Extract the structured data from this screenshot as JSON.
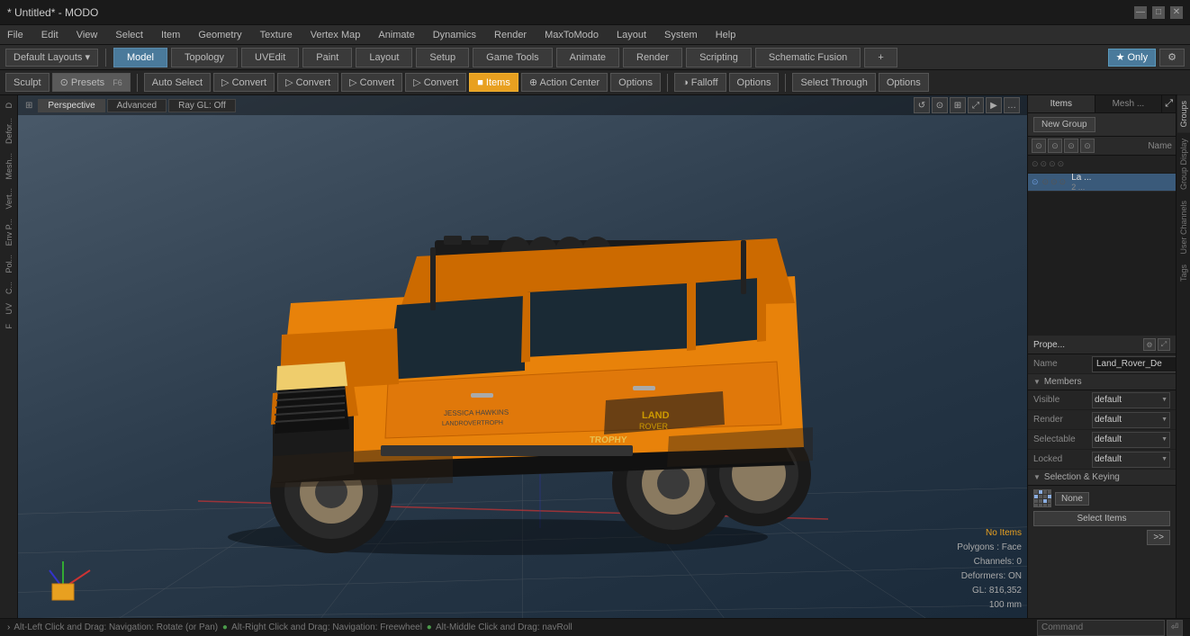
{
  "window": {
    "title": "* Untitled* - MODO",
    "controls": [
      "—",
      "□",
      "✕"
    ]
  },
  "menu": {
    "items": [
      "File",
      "Edit",
      "View",
      "Select",
      "Item",
      "Geometry",
      "Texture",
      "Vertex Map",
      "Animate",
      "Dynamics",
      "Render",
      "MaxToModo",
      "Layout",
      "System",
      "Help"
    ]
  },
  "toolbar1": {
    "default_layouts": "Default Layouts ▾",
    "mode_label": "Model",
    "tabs": [
      "Model",
      "Topology",
      "UVEdit",
      "Paint",
      "Layout",
      "Setup",
      "Game Tools",
      "Animate",
      "Render",
      "Scripting",
      "Schematic Fusion",
      "+"
    ],
    "star_only": "★ Only",
    "settings_icon": "⚙"
  },
  "toolbar2": {
    "sculpt_label": "Sculpt",
    "presets_label": "⊙ Presets",
    "presets_shortcut": "F6",
    "auto_select": "Auto Select",
    "convert_btns": [
      "Convert",
      "Convert",
      "Convert",
      "Convert"
    ],
    "items_label": "Items",
    "action_center": "Action Center",
    "options_label": "Options",
    "falloff_label": "Falloff",
    "options2_label": "Options",
    "select_through": "Select Through",
    "options3_label": "Options"
  },
  "viewport": {
    "tabs": [
      "Perspective",
      "Advanced",
      "Ray GL: Off"
    ],
    "controls": [
      "↺",
      "⊙",
      "⊞",
      "⤢",
      "▶",
      "…"
    ],
    "header_left_icon": "⊞"
  },
  "viewport_info": {
    "no_items": "No Items",
    "polygons": "Polygons : Face",
    "channels": "Channels: 0",
    "deformers": "Deformers: ON",
    "gl": "GL: 816,352",
    "size": "100 mm"
  },
  "nav_hint": {
    "text": "Alt-Left Click and Drag: Navigation: Rotate (or Pan) ● Alt-Right Click and Drag: Navigation: Freewheel ● Alt-Middle Click and Drag: navRoll",
    "arrow": "›",
    "cmd_placeholder": "Command"
  },
  "right_panel": {
    "tabs": [
      "Items",
      "Mesh ..."
    ],
    "expand_icon": "⤢",
    "new_group_label": "New Group",
    "header_btns": [
      "⊙",
      "⊙",
      "⊙",
      "⊙"
    ],
    "name_col": "Name",
    "items": [
      {
        "name": "La ...",
        "sub": "2 ...",
        "selected": true
      }
    ]
  },
  "properties": {
    "header": "Prope...",
    "expand_icon": "⤢",
    "name_label": "Name",
    "name_value": "Land_Rover_De",
    "members_label": "Members",
    "visible_label": "Visible",
    "visible_value": "default",
    "render_label": "Render",
    "render_value": "default",
    "selectable_label": "Selectable",
    "selectable_value": "default",
    "locked_label": "Locked",
    "locked_value": "default",
    "sel_keying_label": "Selection & Keying",
    "grid_label": "None",
    "select_items_label": "Select Items",
    "forward_btn": ">>"
  },
  "right_side_tabs": [
    "Groups",
    "Group Display",
    "User Channels",
    "Tags"
  ],
  "left_sidebar_tabs": [
    "D",
    "Defor...",
    "Mesh...",
    "Vert...",
    "Env P...",
    "Pol...",
    "C...",
    "UV",
    "F"
  ]
}
